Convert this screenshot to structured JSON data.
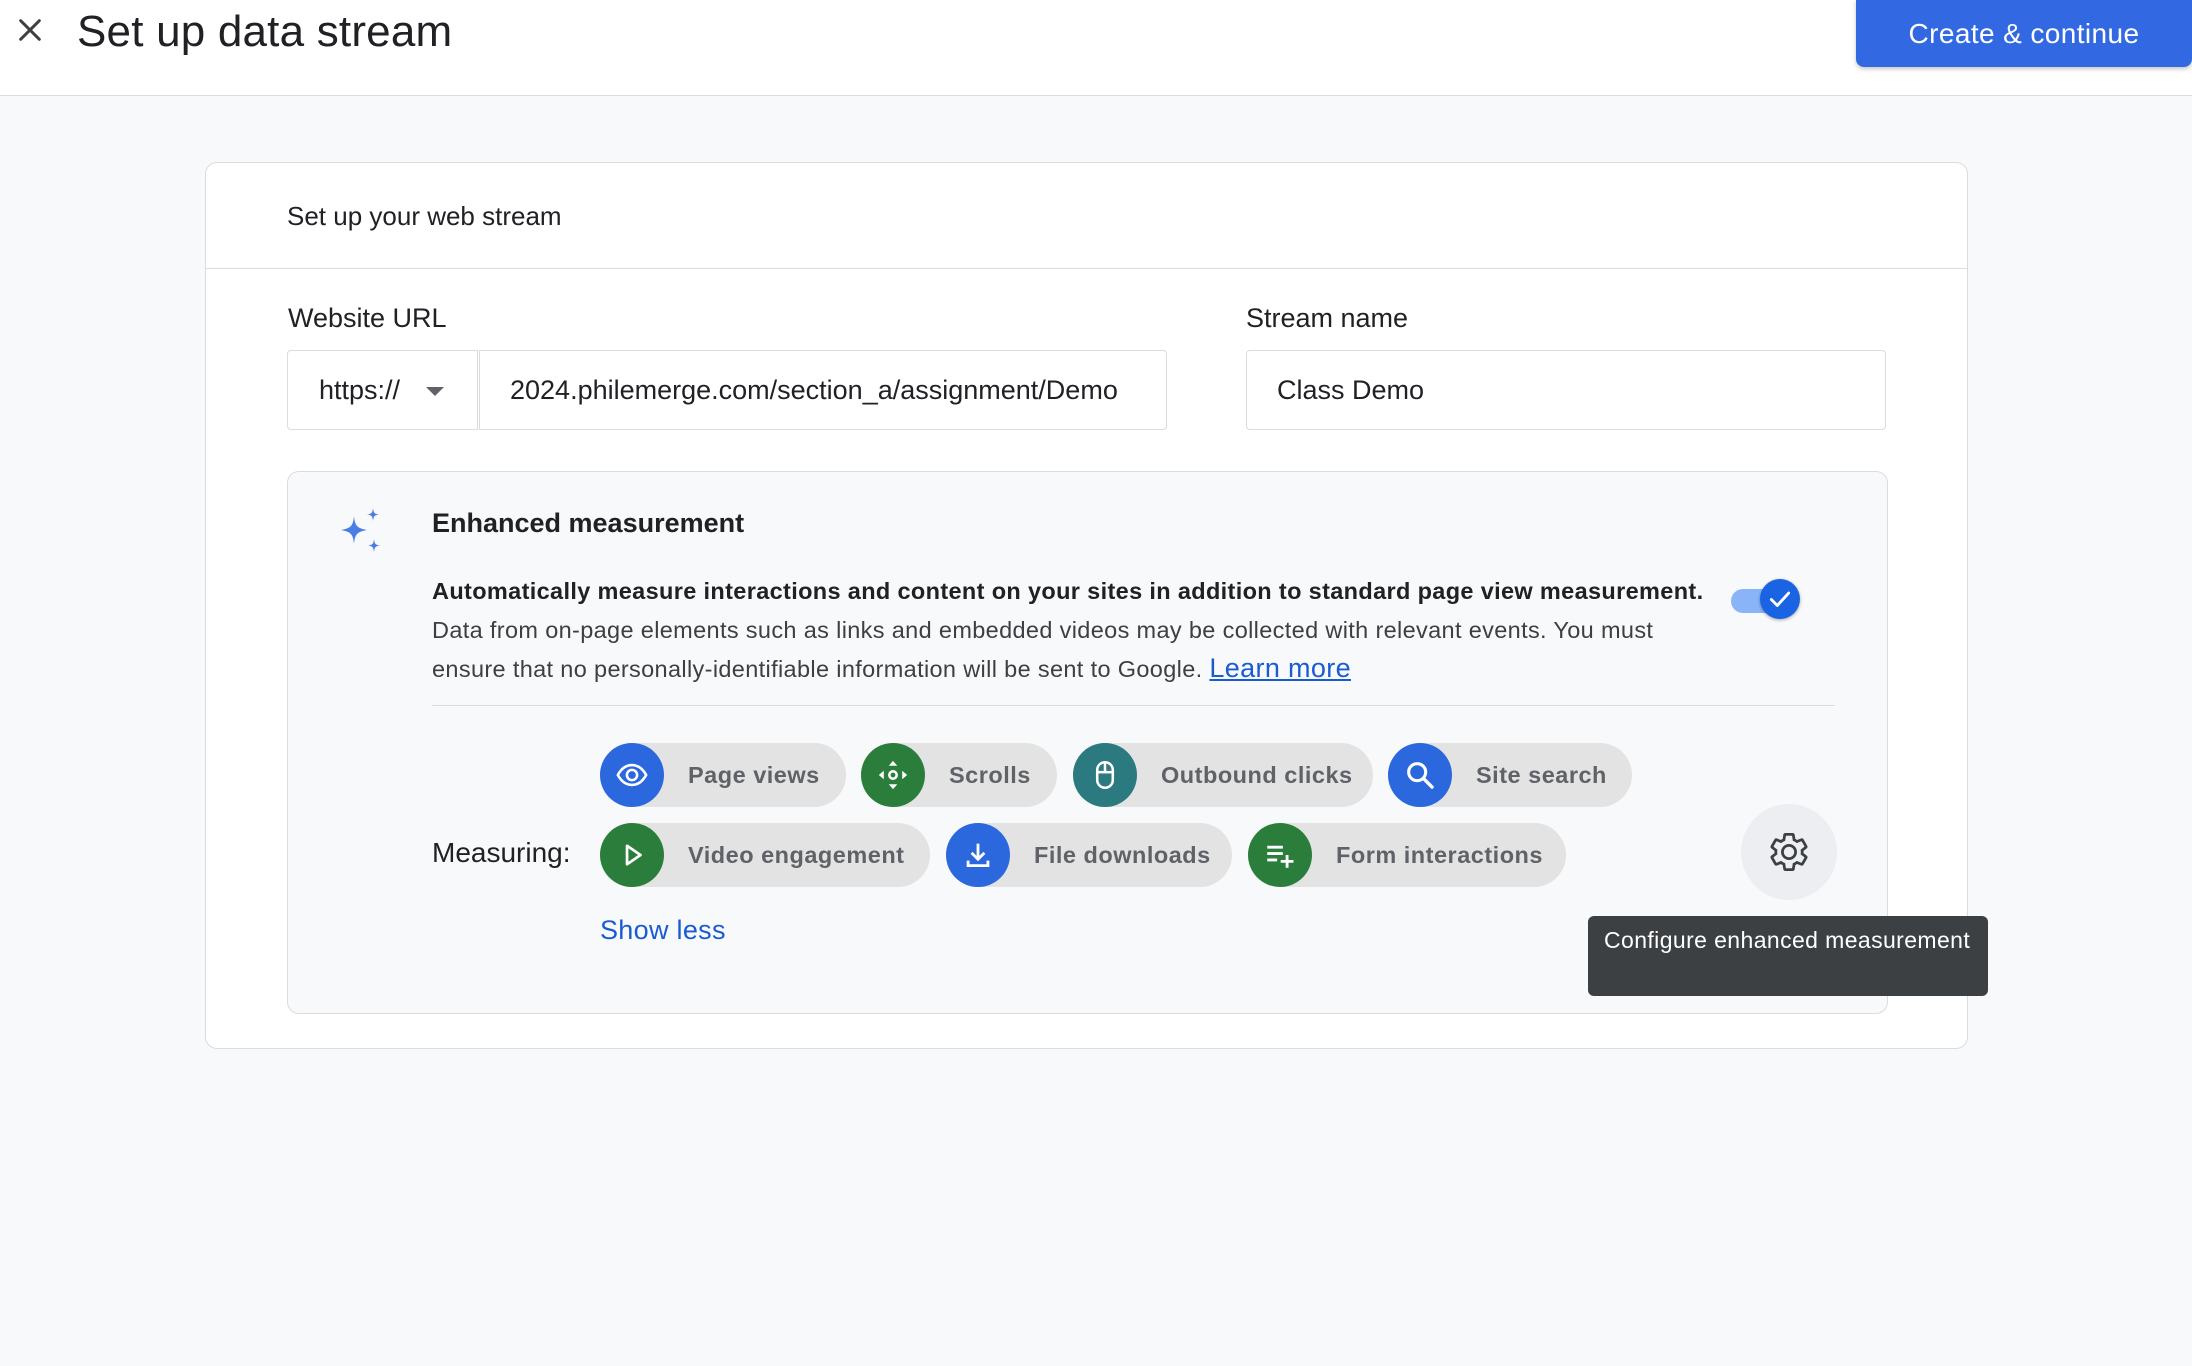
{
  "header": {
    "title": "Set up data stream",
    "create_button": "Create & continue"
  },
  "card": {
    "title": "Set up your web stream",
    "website_url_label": "Website URL",
    "protocol": "https://",
    "url_value": "2024.philemerge.com/section_a/assignment/Demo",
    "stream_name_label": "Stream name",
    "stream_name_value": "Class Demo"
  },
  "enhanced": {
    "title": "Enhanced measurement",
    "desc_bold": "Automatically measure interactions and content on your sites in addition to standard page view measurement.",
    "desc_text": "Data from on-page elements such as links and embedded videos may be collected with relevant events. You must ensure that no personally-identifiable information will be sent to Google.",
    "learn_more": "Learn more",
    "toggle_on": true,
    "measuring_label": "Measuring:",
    "chips": [
      {
        "label": "Page views",
        "icon": "eye-icon",
        "color": "#2b67dd"
      },
      {
        "label": "Scrolls",
        "icon": "scroll-arrows-icon",
        "color": "#2b7d3c"
      },
      {
        "label": "Outbound clicks",
        "icon": "mouse-icon",
        "color": "#2a7a80"
      },
      {
        "label": "Site search",
        "icon": "search-icon",
        "color": "#2b67dd"
      },
      {
        "label": "Video engagement",
        "icon": "play-icon",
        "color": "#2b7d3c"
      },
      {
        "label": "File downloads",
        "icon": "download-icon",
        "color": "#2b67dd"
      },
      {
        "label": "Form interactions",
        "icon": "playlist-add-icon",
        "color": "#2b7d3c"
      }
    ],
    "show_less": "Show less",
    "tooltip": "Configure enhanced measurement"
  }
}
